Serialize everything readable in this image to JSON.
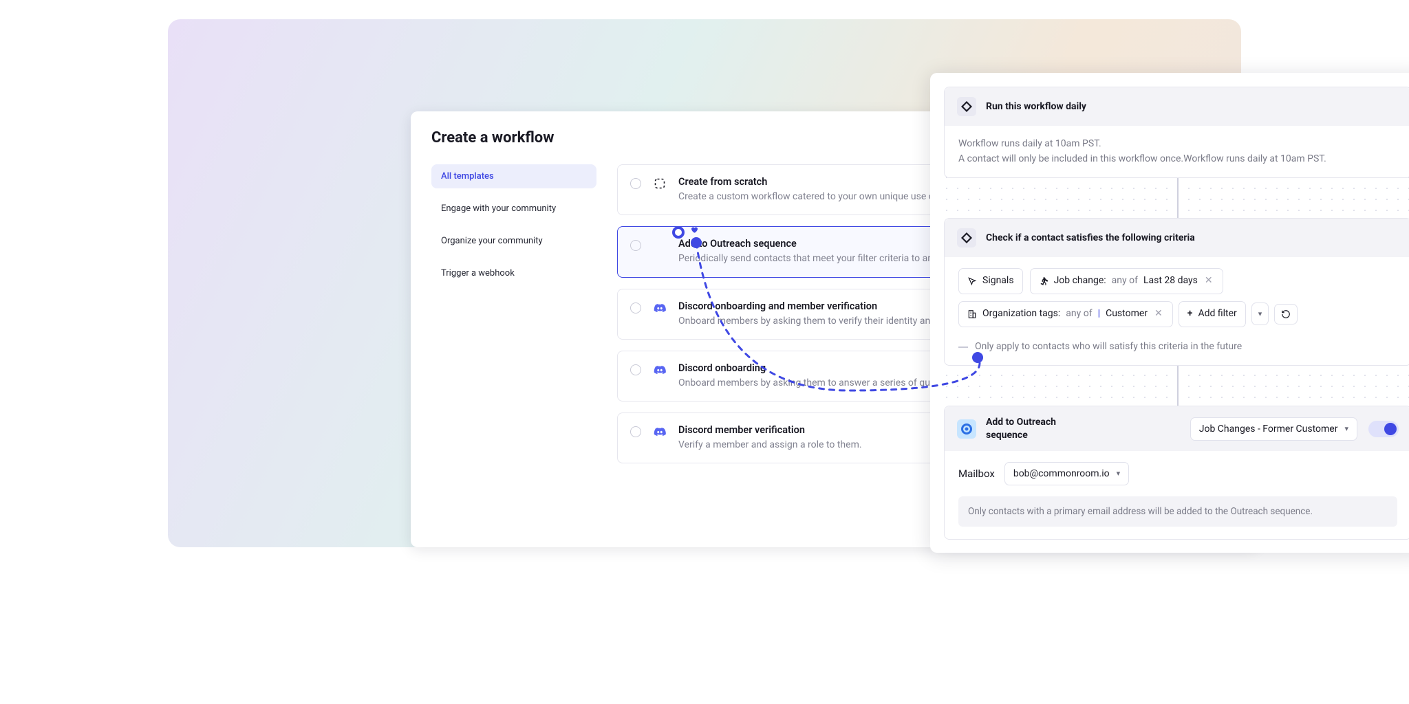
{
  "workflow": {
    "title": "Create a workflow",
    "sidebar": [
      {
        "label": "All templates",
        "active": true
      },
      {
        "label": "Engage with your community",
        "active": false
      },
      {
        "label": "Organize your community",
        "active": false
      },
      {
        "label": "Trigger a webhook",
        "active": false
      }
    ],
    "templates": [
      {
        "icon": "scratch-icon",
        "title": "Create from scratch",
        "desc": "Create a custom workflow catered to your own unique use case.",
        "selected": false
      },
      {
        "icon": "outreach-icon",
        "title": "Add to Outreach sequence",
        "desc": "Periodically send contacts that meet your filter criteria to an Outreach sequence.",
        "selected": true
      },
      {
        "icon": "discord-icon",
        "title": "Discord onboarding and member verification",
        "desc": "Onboard members by asking them to verify their identity and answer a series of questions that optionally assign them a role.",
        "selected": false
      },
      {
        "icon": "discord-icon",
        "title": "Discord onboarding",
        "desc": "Onboard members by asking them to answer a series of questions that optionally assign them a role.",
        "selected": false
      },
      {
        "icon": "discord-icon",
        "title": "Discord member verification",
        "desc": "Verify a member and assign a role to them.",
        "selected": false
      }
    ]
  },
  "detail": {
    "trigger": {
      "title": "Run this workflow daily",
      "body1": "Workflow runs daily at 10am PST.",
      "body2": "A contact will only be included in this workflow once.Workflow runs daily at 10am PST."
    },
    "criteria": {
      "title": "Check if a contact satisfies the following criteria",
      "signals_label": "Signals",
      "filter1_label": "Job change:",
      "filter1_op": "any of",
      "filter1_value": "Last 28 days",
      "filter2_label": "Organization tags:",
      "filter2_op": "any of",
      "filter2_value": "Customer",
      "add_filter": "Add filter",
      "future_note": "Only apply to contacts who will satisfy this criteria in the future"
    },
    "action": {
      "title": "Add to Outreach sequence",
      "sequence_value": "Job Changes - Former Customer",
      "toggle_on": true,
      "mailbox_label": "Mailbox",
      "mailbox_value": "bob@commonroom.io",
      "info": "Only contacts with a primary email address will be added to the Outreach sequence."
    }
  }
}
